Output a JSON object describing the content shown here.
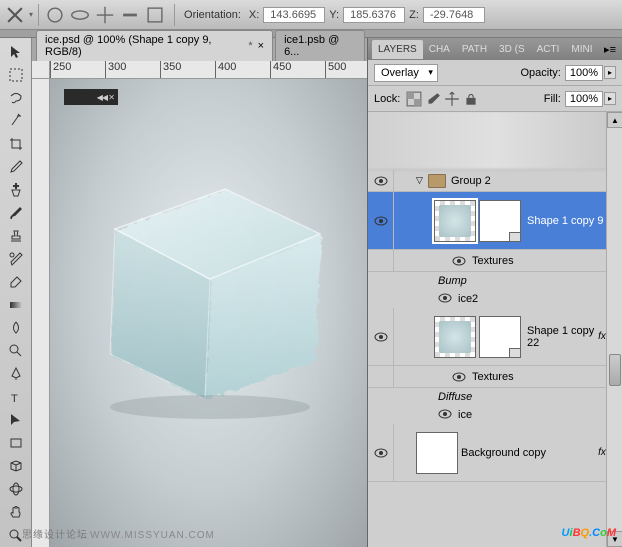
{
  "toolbar": {
    "orientation_label": "Orientation:",
    "x_label": "X:",
    "x_value": "143.6695",
    "y_label": "Y:",
    "y_value": "185.6376",
    "z_label": "Z:",
    "z_value": "-29.7648"
  },
  "tabs": [
    {
      "title": "ice.psd @ 100% (Shape 1 copy 9, RGB/8)",
      "modified": "*",
      "active": true
    },
    {
      "title": "ice1.psb @ 6...",
      "modified": "",
      "active": false
    }
  ],
  "ruler_ticks": [
    "250",
    "300",
    "350",
    "400",
    "450",
    "500"
  ],
  "panel_tabs": [
    "LAYERS",
    "CHA",
    "PATH",
    "3D (S",
    "ACTI",
    "MINI"
  ],
  "blend": {
    "mode": "Overlay",
    "opacity_label": "Opacity:",
    "opacity_value": "100%",
    "lock_label": "Lock:",
    "fill_label": "Fill:",
    "fill_value": "100%"
  },
  "layers": {
    "group": "Group 2",
    "shape9": "Shape 1 copy 9",
    "textures1": "Textures",
    "bump": "Bump",
    "ice2": "ice2",
    "shape22": "Shape 1 copy 22",
    "textures2": "Textures",
    "diffuse": "Diffuse",
    "ice": "ice",
    "bgcopy": "Background copy",
    "fx": "fx"
  },
  "watermarks": {
    "left": "思缘设计论坛",
    "url": "WWW.MISSYUAN.COM",
    "nav_proxy": "◀◀ ✕"
  }
}
